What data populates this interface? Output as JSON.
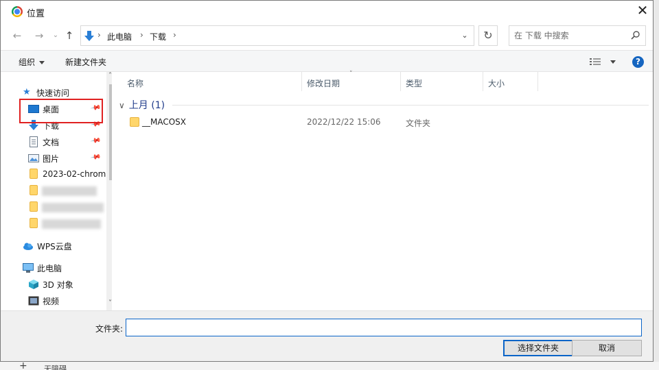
{
  "window": {
    "title": "位置",
    "close_glyph": "✕"
  },
  "nav": {
    "back_glyph": "←",
    "forward_glyph": "→",
    "dropdown_glyph": "⌄",
    "up_glyph": "↑"
  },
  "address": {
    "breadcrumbs": [
      "此电脑",
      "下载"
    ],
    "separator": "›",
    "dropdown_glyph": "⌄",
    "refresh_glyph": "↻"
  },
  "search": {
    "placeholder": "在 下载 中搜索"
  },
  "toolbar": {
    "organize": "组织",
    "new_folder": "新建文件夹",
    "help": "?"
  },
  "sidebar": {
    "quick_access": "快速访问",
    "items": [
      {
        "label": "桌面",
        "icon": "desktop-icon",
        "pinned": true
      },
      {
        "label": "下载",
        "icon": "download-icon",
        "pinned": true
      },
      {
        "label": "文档",
        "icon": "document-icon",
        "pinned": true
      },
      {
        "label": "图片",
        "icon": "pictures-icon",
        "pinned": true
      },
      {
        "label": "2023-02-chrom",
        "icon": "folder-icon",
        "pinned": false
      }
    ],
    "wps": "WPS云盘",
    "this_pc": "此电脑",
    "pc_items": [
      {
        "label": "3D 对象",
        "icon": "3d-objects-icon"
      },
      {
        "label": "视频",
        "icon": "video-icon"
      }
    ],
    "pin_glyph": "📌",
    "scroll_up": "˄",
    "scroll_down": "˅"
  },
  "columns": {
    "name": "名称",
    "date": "修改日期",
    "type": "类型",
    "size": "大小",
    "sort_glyph": "˅"
  },
  "group": {
    "label": "上月 (1)",
    "chevron": "∨"
  },
  "files": [
    {
      "name": "__MACOSX",
      "date": "2022/12/22 15:06",
      "type": "文件夹",
      "size": ""
    }
  ],
  "footer": {
    "folder_label": "文件夹:",
    "folder_value": "",
    "select_button": "选择文件夹",
    "cancel_button": "取消"
  },
  "background": {
    "text": "无障碍",
    "plus": "+"
  },
  "colors": {
    "accent": "#0a64c8",
    "highlight": "#e02020",
    "folder": "#ffd66b",
    "group_text": "#1e3a8a"
  }
}
